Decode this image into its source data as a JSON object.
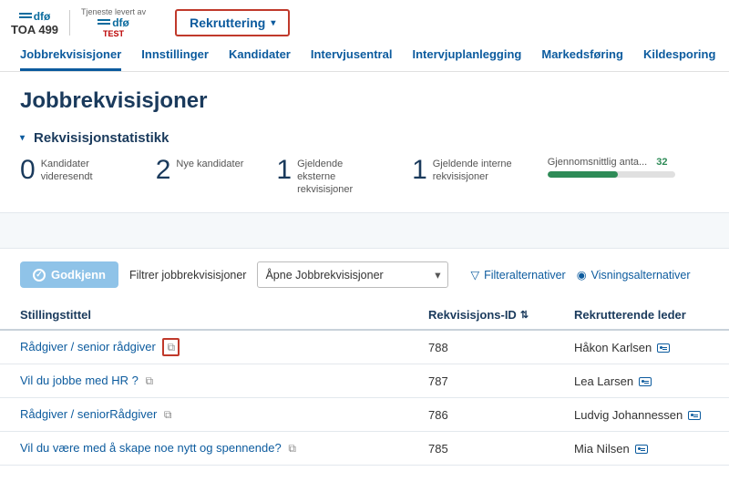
{
  "header": {
    "brand1_line1": "dfø",
    "brand1_line2": "TOA 499",
    "sublabel": "Tjeneste levert av",
    "brand2": "dfø",
    "test_tag": "TEST",
    "module_dropdown": "Rekruttering"
  },
  "nav": {
    "tabs": [
      {
        "label": "Jobbrekvisisjoner",
        "active": true
      },
      {
        "label": "Innstillinger",
        "active": false
      },
      {
        "label": "Kandidater",
        "active": false
      },
      {
        "label": "Intervjusentral",
        "active": false
      },
      {
        "label": "Intervjuplanlegging",
        "active": false
      },
      {
        "label": "Markedsføring",
        "active": false
      },
      {
        "label": "Kildesporing",
        "active": false
      }
    ]
  },
  "page_title": "Jobbrekvisisjoner",
  "stats": {
    "heading": "Rekvisisjonstatistikk",
    "items": [
      {
        "value": "0",
        "label": "Kandidater videresendt"
      },
      {
        "value": "2",
        "label": "Nye kandidater"
      },
      {
        "value": "1",
        "label": "Gjeldende eksterne rekvisisjoner"
      },
      {
        "value": "1",
        "label": "Gjeldende interne rekvisisjoner"
      }
    ],
    "avg_label": "Gjennomsnittlig anta...",
    "avg_value": "32",
    "avg_pct": 55
  },
  "toolbar": {
    "approve_label": "Godkjenn",
    "filter_label": "Filtrer jobbrekvisisjoner",
    "select_value": "Åpne Jobbrekvisisjoner",
    "filter_alt": "Filteralternativer",
    "view_alt": "Visningsalternativer"
  },
  "table": {
    "headers": {
      "title": "Stillingstittel",
      "id": "Rekvisisjons-ID",
      "manager": "Rekrutterende leder"
    },
    "rows": [
      {
        "title": "Rådgiver / senior rådgiver",
        "id": "788",
        "manager": "Håkon Karlsen",
        "highlight_icon": true
      },
      {
        "title": "Vil du jobbe med HR ?",
        "id": "787",
        "manager": "Lea Larsen",
        "highlight_icon": false
      },
      {
        "title": "Rådgiver / seniorRådgiver",
        "id": "786",
        "manager": "Ludvig Johannessen",
        "highlight_icon": false
      },
      {
        "title": "Vil du være med å skape noe nytt og spennende?",
        "id": "785",
        "manager": "Mia Nilsen",
        "highlight_icon": false
      }
    ]
  }
}
